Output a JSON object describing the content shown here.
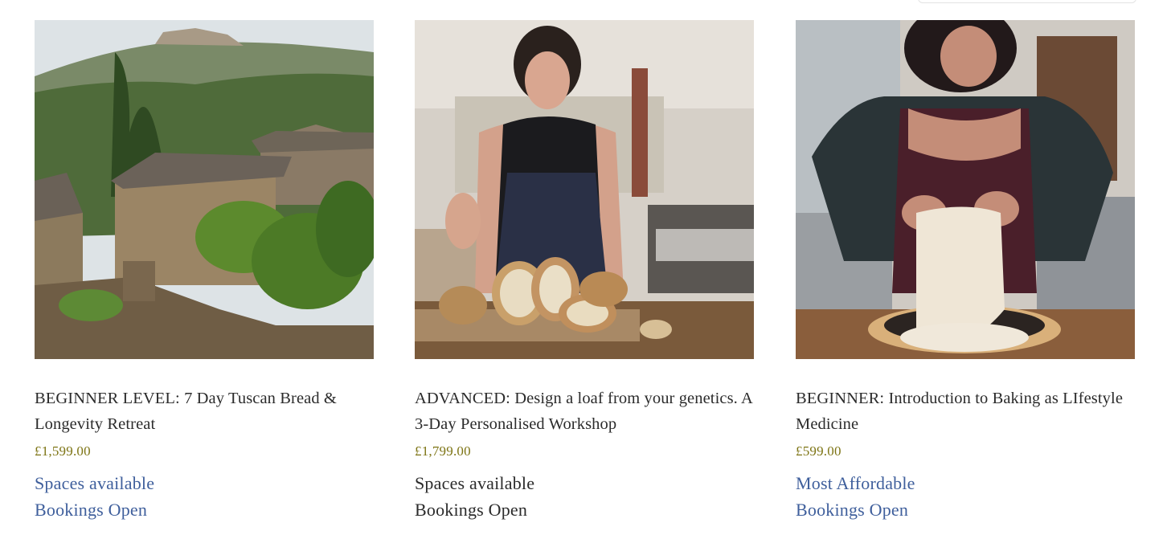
{
  "products": [
    {
      "title": "BEGINNER LEVEL: 7 Day Tuscan Bread & Longevity Retreat",
      "price": "£1,599.00",
      "badges": [
        "Spaces available",
        "Bookings Open"
      ],
      "image_alt": "Tuscan hillside village with stone houses"
    },
    {
      "title": "ADVANCED: Design a loaf from your genetics. A 3-Day Personalised Workshop",
      "price": "£1,799.00",
      "badges": [
        "Spaces available",
        "Bookings Open"
      ],
      "image_alt": "Baker presenting sliced sourdough loaves"
    },
    {
      "title": "BEGINNER: Introduction to Baking as LIfestyle Medicine",
      "price": "£599.00",
      "badges": [
        "Most Affordable",
        "Bookings Open"
      ],
      "image_alt": "Baker stretching dough over a wooden bowl"
    }
  ],
  "colors": {
    "price": "#7d7414",
    "badge_blue": "#3f5f9c",
    "title": "#2b2b2b"
  }
}
